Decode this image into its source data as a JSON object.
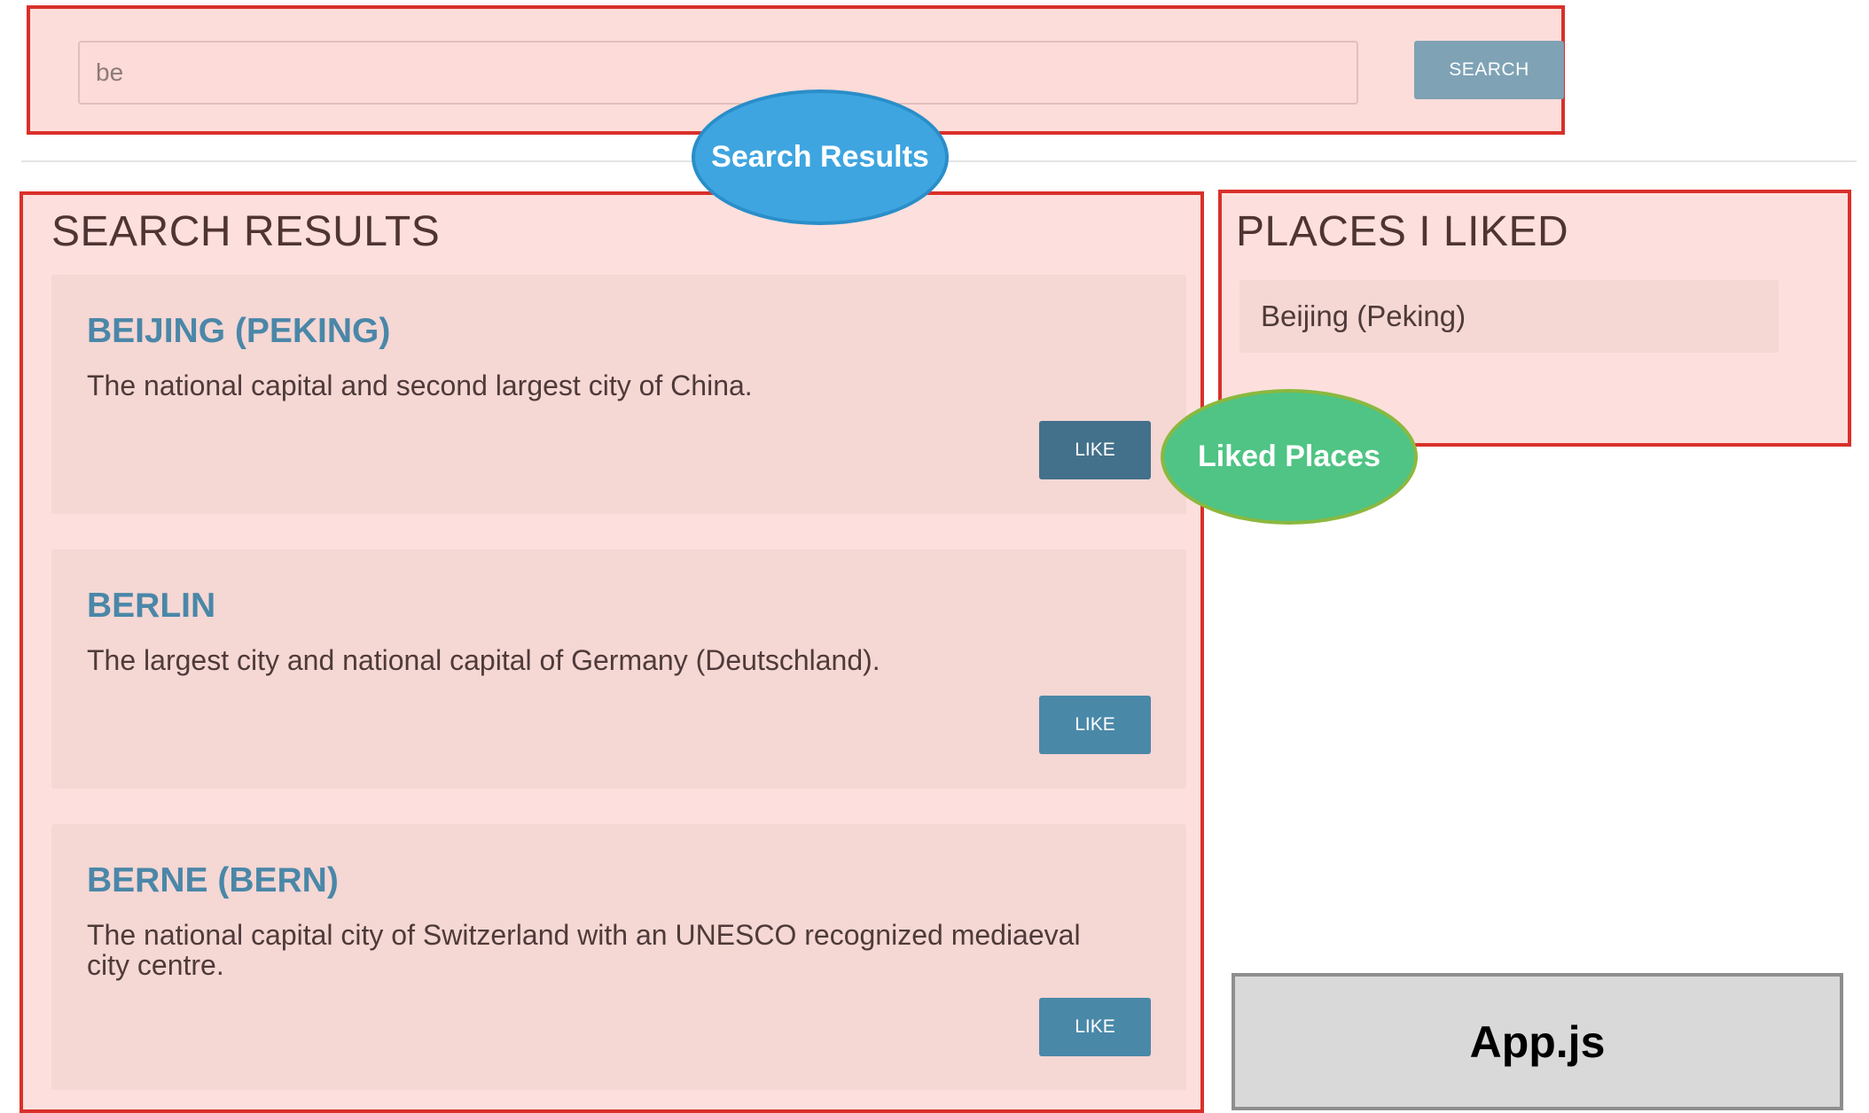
{
  "search": {
    "value": "be",
    "placeholder": "",
    "button_label": "SEARCH"
  },
  "results": {
    "title": "SEARCH RESULTS",
    "items": [
      {
        "name": "BEIJING (PEKING)",
        "description": "The national capital and second largest city of China.",
        "like_label": "LIKE"
      },
      {
        "name": "BERLIN",
        "description": "The largest city and national capital of Germany (Deutschland).",
        "like_label": "LIKE"
      },
      {
        "name": "BERNE (BERN)",
        "description": "The national capital city of Switzerland with an UNESCO recognized mediaeval city centre.",
        "like_label": "LIKE"
      }
    ]
  },
  "liked": {
    "title": "PLACES I LIKED",
    "items": [
      "Beijing (Peking)"
    ]
  },
  "annotations": {
    "search_results": "Search Results",
    "liked_places": "Liked Places",
    "app_component": "App.js"
  },
  "colors": {
    "component_border": "#d9302a",
    "component_fill": "#fde0dd",
    "card_fill": "#f5d7d4",
    "heading_blue": "#4a87a8",
    "search_callout": "#3fa5e0",
    "liked_callout": "#4fc484",
    "app_box": "#d9d9d9"
  }
}
